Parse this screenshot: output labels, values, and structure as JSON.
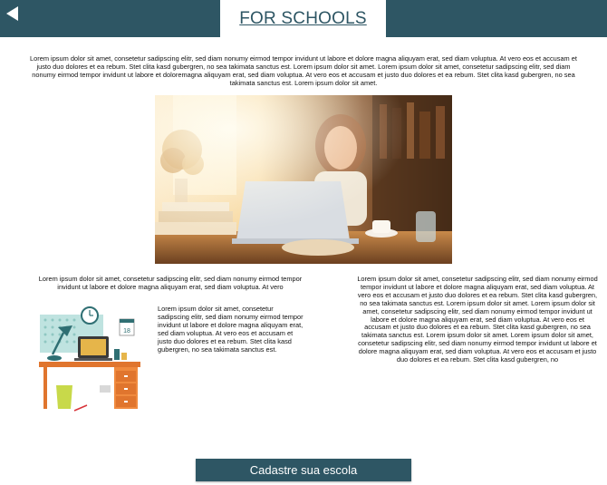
{
  "header": {
    "title": "FOR SCHOOLS",
    "back_icon": "back-arrow-icon",
    "background_color": "#2e5664"
  },
  "intro": {
    "text": "Lorem ipsum dolor sit amet, consetetur sadipscing elitr, sed diam nonumy eirmod tempor invidunt ut labore et dolore magna aliquyam erat, sed diam voluptua. At vero eos et accusam et justo duo dolores et ea rebum. Stet clita kasd gubergren, no sea takimata sanctus est. Lorem ipsum dolor sit amet. Lorem ipsum dolor sit amet, consetetur sadipscing elitr, sed diam nonumy eirmod tempor invidunt ut labore et doloremagna aliquyam erat, sed diam voluptua. At vero eos et accusam et justo duo dolores et ea rebum. Stet clita kasd gubergren, no sea takimata sanctus est. Lorem ipsum dolor sit amet."
  },
  "left_column": {
    "text": "Lorem ipsum dolor sit amet, consetetur sadipscing elitr, sed diam nonumy eirmod tempor invidunt ut labore et dolore magna aliquyam erat, sed diam voluptua. At vero",
    "side_text": "Lorem ipsum dolor sit amet, consetetur sadipscing elitr, sed diam nonumy eirmod tempor invidunt ut labore et dolore magna aliquyam erat, sed diam voluptua. At vero eos et accusam et justo duo dolores et ea rebum. Stet clita kasd gubergren, no sea takimata sanctus est.",
    "calendar_number": "18"
  },
  "right_column": {
    "text": "Lorem ipsum dolor sit amet, consetetur sadipscing elitr, sed diam nonumy eirmod tempor invidunt ut labore et dolore magna aliquyam erat, sed diam voluptua. At vero eos et accusam et justo duo dolores et ea rebum. Stet clita kasd gubergren, no sea takimata sanctus est. Lorem ipsum dolor sit amet. Lorem ipsum dolor sit amet, consetetur sadipscing elitr, sed diam nonumy eirmod tempor invidunt ut labore et dolore magna aliquyam erat, sed diam voluptua. At vero eos et accusam et justo duo dolores et ea rebum. Stet clita kasd gubergren, no sea takimata sanctus est. Lorem ipsum dolor sit amet. Lorem ipsum dolor sit amet, consetetur sadipscing elitr, sed diam nonumy eirmod tempor invidunt ut labore et dolore magna aliquyam erat, sed diam voluptua. At vero eos et accusam et justo duo dolores et ea rebum. Stet clita kasd gubergren, no"
  },
  "cta": {
    "label": "Cadastre sua escola"
  }
}
